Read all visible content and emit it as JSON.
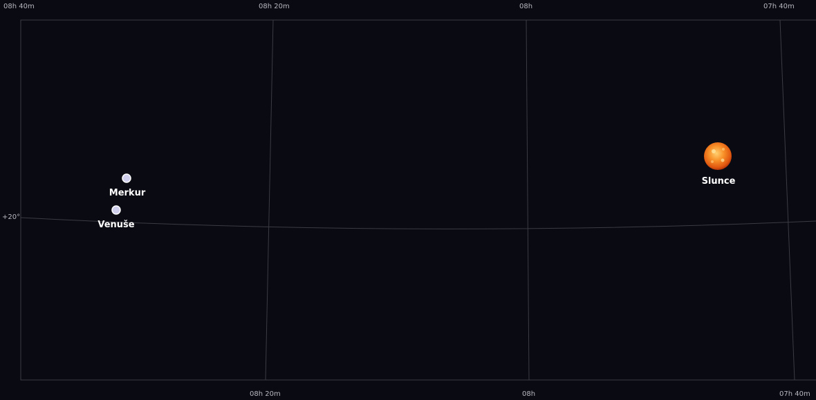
{
  "chart": {
    "ra_ticks_top": [
      "08h 40m",
      "08h 20m",
      "08h",
      "07h 40m"
    ],
    "ra_ticks_bottom": [
      "08h 20m",
      "08h",
      "07h 40m"
    ],
    "dec_ticks": [
      "+20°"
    ]
  },
  "bodies": [
    {
      "name": "Merkur",
      "kind": "planet",
      "color": "#d0d0ee"
    },
    {
      "name": "Venuše",
      "kind": "planet",
      "color": "#d0d0ee"
    },
    {
      "name": "Slunce",
      "kind": "sun",
      "color": "#f07818"
    }
  ],
  "colors": {
    "background": "#0a0a12",
    "grid": "#3c3c44",
    "label": "#ffffff"
  }
}
